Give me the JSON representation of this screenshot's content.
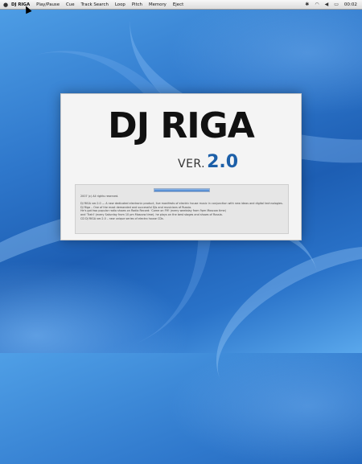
{
  "menubar": {
    "app_name": "DJ RIGA",
    "items": [
      "Play/Pause",
      "Cue",
      "Track Search",
      "Loop",
      "Pitch",
      "Memory",
      "Eject"
    ],
    "clock": "00:02"
  },
  "splash": {
    "title": "DJ RIGA",
    "version_prefix": "VER.",
    "version_number": "2.0",
    "progress": 1.0,
    "info_lines": [
      "2007 (c) All rights reserved.",
      "",
      "DJ RIGA ver.2.0 — A new dedicated electronic product, live manifests of electric house music in conjunction with new ideas and digital technologies.",
      "DJ Riga – One of the most demanded and successful DJs and musicians of Russia.",
      "He's got two popular radio shows on Radio Record: 'Come on FM' (every weekday from 9pm Moscow time)",
      "and 'Trahl' (every Saturday from 10 pm Moscow time). he plays on the best stages and shows of Russia.",
      "CD DJ RIGA ver.2.0 – new unique series of electro house CDs."
    ]
  },
  "colors": {
    "version_accent": "#1c5fa8",
    "desktop": "#2f78cc"
  },
  "icons": [
    "apple-icon",
    "bluetooth-icon",
    "wifi-icon",
    "volume-icon",
    "battery-icon"
  ]
}
